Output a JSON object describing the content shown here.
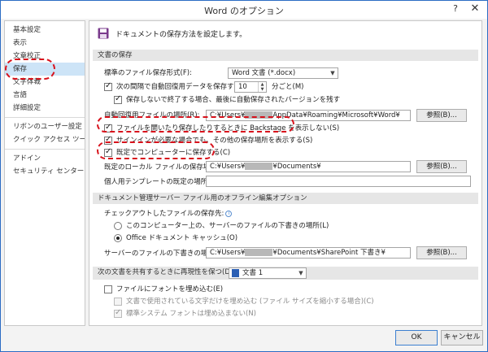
{
  "window": {
    "title": "Word のオプション",
    "help_glyph": "?",
    "close_glyph": "✕"
  },
  "sidebar": {
    "items": [
      "基本設定",
      "表示",
      "文章校正",
      "保存",
      "文字体裁",
      "言語",
      "詳細設定",
      "リボンのユーザー設定",
      "クイック アクセス ツール バー",
      "アドイン",
      "セキュリティ センター"
    ],
    "selected": "保存"
  },
  "heading": {
    "text": "ドキュメントの保存方法を設定します。",
    "icon": "floppy-disk-icon"
  },
  "save_section": {
    "header": "文書の保存",
    "format_label": "標準のファイル保存形式(F):",
    "format_value": "Word 文書 (*.docx)",
    "autorecover_label": "次の間隔で自動回復用データを保存する(A):",
    "autorecover_checked": true,
    "autorecover_minutes": "10",
    "minutes_unit": "分ごと(M)",
    "keep_last_label": "保存しないで終了する場合、最後に自動保存されたバージョンを残す",
    "keep_last_checked": true,
    "autorecover_location_label": "自動回復用ファイルの場所(R):",
    "autorecover_location_prefix": "C:¥Users¥",
    "autorecover_location_suffix": "AppData¥Roaming¥Microsoft¥Word¥",
    "browse_label_1": "参照(B)...",
    "no_backstage_label": "ファイルを開いたり保存したりするときに Backstage を表示しない(S)",
    "no_backstage_checked": true,
    "show_more_label": "サインインが必要な場合でも、その他の保存場所を表示する(S)",
    "show_more_checked": true,
    "save_to_computer_label": "既定でコンピューターに保存する(C)",
    "save_to_computer_checked": true,
    "local_location_label": "既定のローカル ファイルの保存場所(I):",
    "local_location_prefix": "C:¥Users¥",
    "local_location_suffix": "¥Documents¥",
    "browse_label_2": "参照(B)...",
    "template_location_label": "個人用テンプレートの既定の場所(T):",
    "template_location_value": ""
  },
  "server_section": {
    "header": "ドキュメント管理サーバー ファイル用のオフライン編集オプション",
    "checkout_label": "チェックアウトしたファイルの保存先:",
    "info_glyph": "i",
    "radio_computer_label": "このコンピューター上の、サーバーのファイルの下書きの場所(L)",
    "radio_computer_selected": false,
    "radio_office_label": "Office ドキュメント キャッシュ(O)",
    "radio_office_selected": true,
    "drafts_label": "サーバーのファイルの下書きの場所(V):",
    "drafts_prefix": "C:¥Users¥",
    "drafts_suffix": "¥Documents¥SharePoint 下書き¥",
    "browse_label_3": "参照(B)..."
  },
  "share_section": {
    "header": "次の文書を共有するときに再現性を保つ(D):",
    "document_value": "文書 1",
    "embed_fonts_label": "ファイルにフォントを埋め込む(E)",
    "embed_fonts_checked": false,
    "embed_used_only_label": "文書で使用されている文字だけを埋め込む (ファイル サイズを縮小する場合)(C)",
    "embed_used_only_checked": false,
    "no_system_fonts_label": "標準システム フォントは埋め込まない(N)",
    "no_system_fonts_checked": true
  },
  "footer": {
    "ok_label": "OK",
    "cancel_label": "キャンセル"
  },
  "colors": {
    "accent": "#2b6cc4",
    "callout": "#d8121c",
    "selection": "#cde4f7"
  }
}
